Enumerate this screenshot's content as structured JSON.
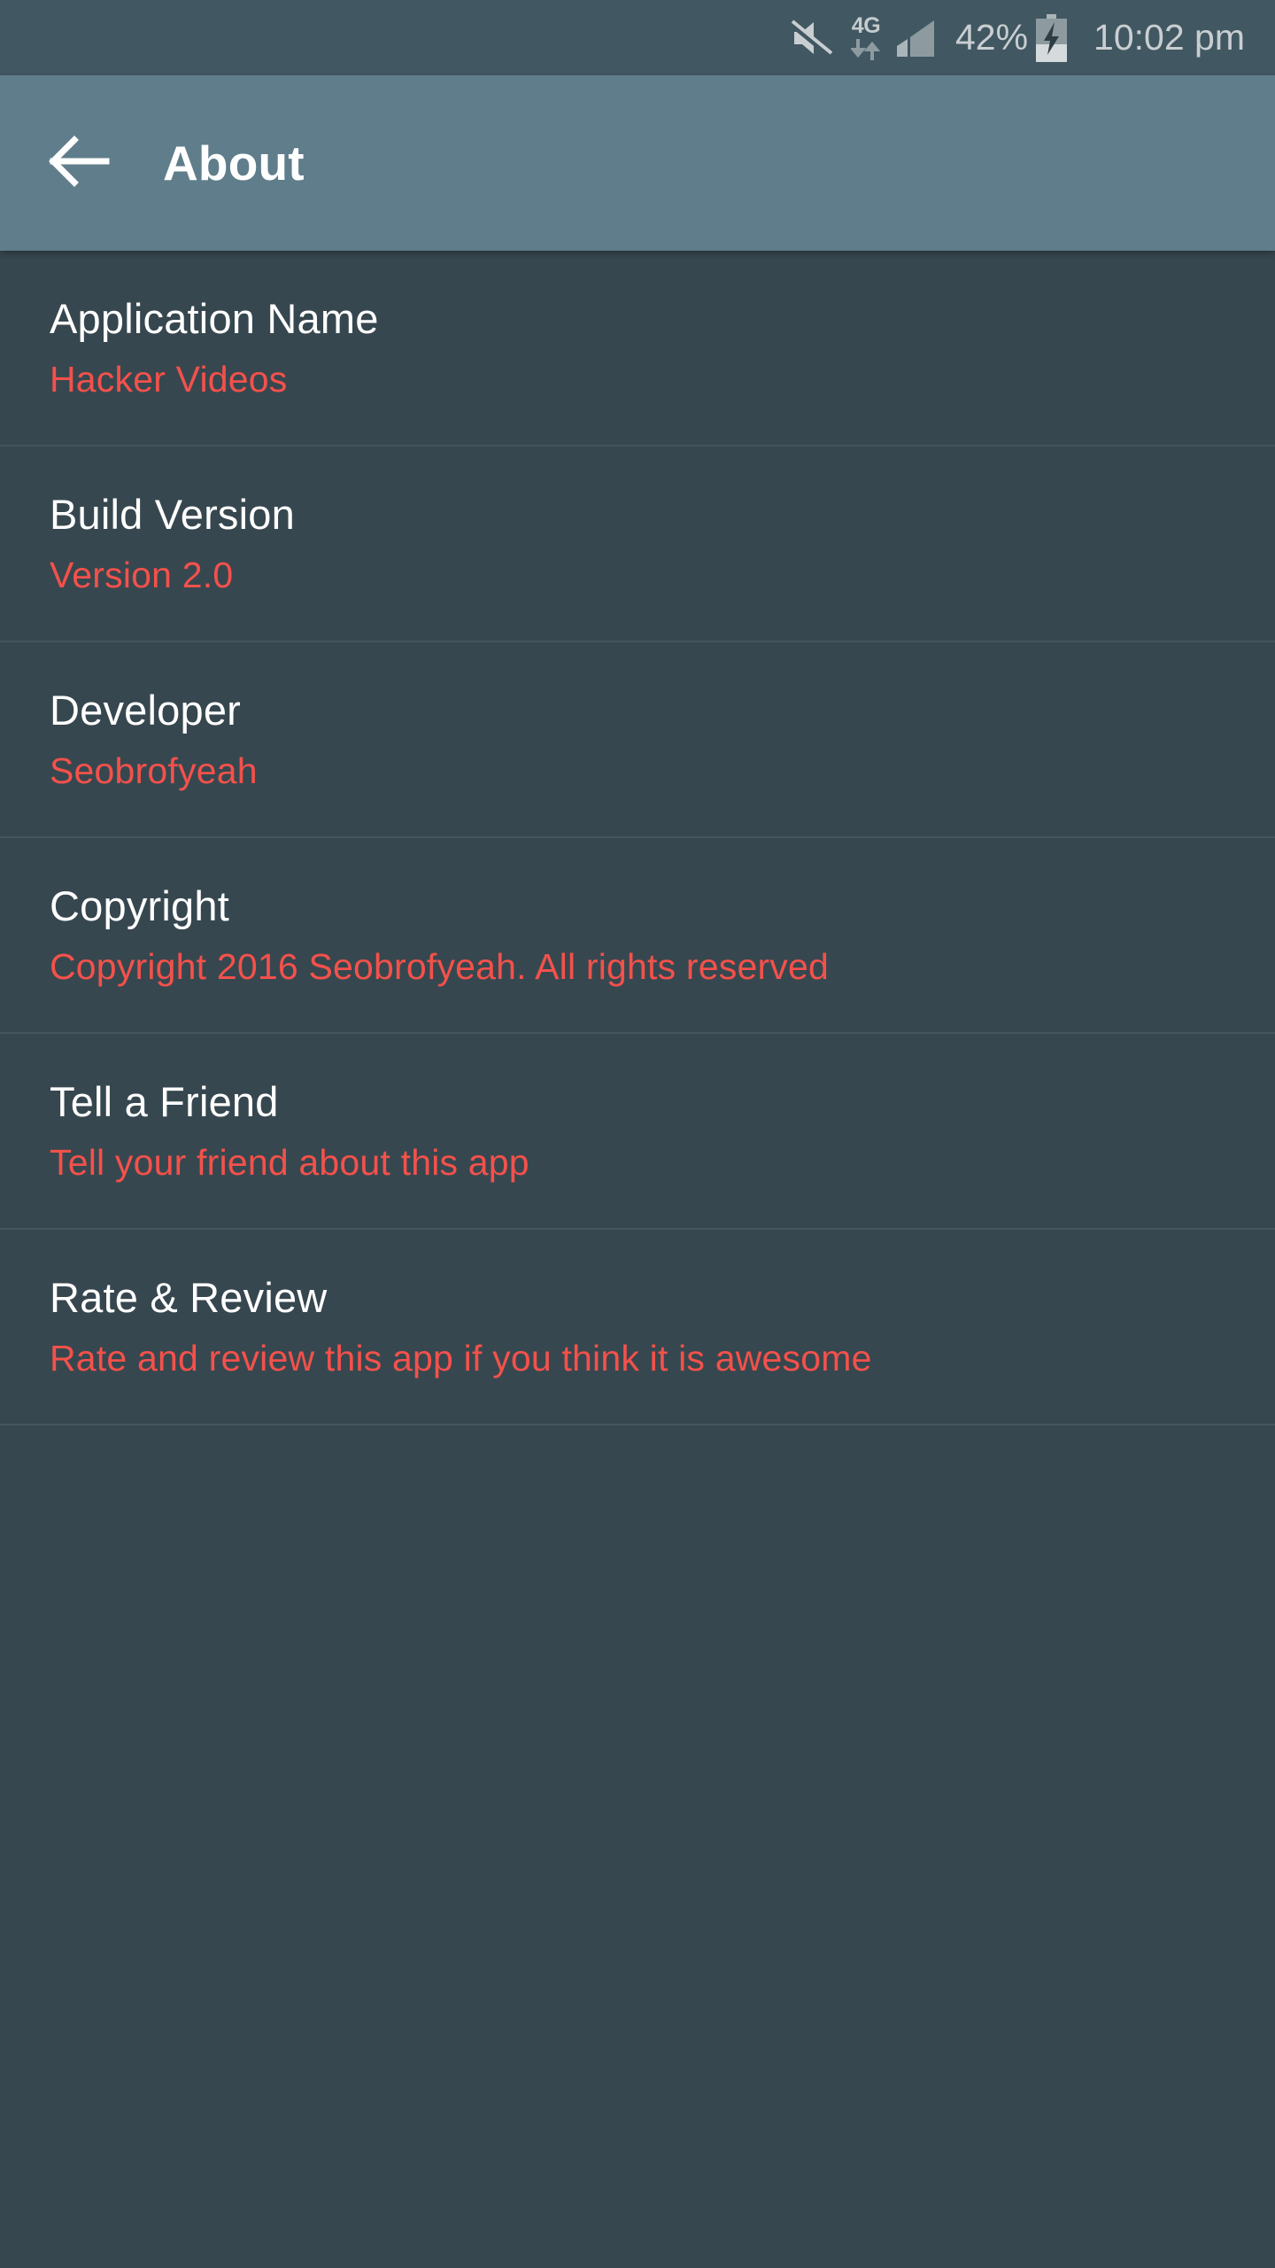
{
  "status_bar": {
    "icons": [
      "mute-icon",
      "4g-data-icon",
      "signal-icon",
      "battery-charging-icon"
    ],
    "network_label": "4G",
    "battery_percent": "42%",
    "clock": "10:02 pm"
  },
  "toolbar": {
    "back_icon": "arrow-left-icon",
    "title": "About"
  },
  "list": {
    "items": [
      {
        "title": "Application Name",
        "subtitle": "Hacker Videos"
      },
      {
        "title": "Build Version",
        "subtitle": "Version 2.0"
      },
      {
        "title": "Developer",
        "subtitle": "Seobrofyeah"
      },
      {
        "title": "Copyright",
        "subtitle": "Copyright 2016 Seobrofyeah. All rights reserved"
      },
      {
        "title": "Tell a Friend",
        "subtitle": "Tell your friend about this app"
      },
      {
        "title": "Rate & Review",
        "subtitle": "Rate and review this app if you think it is awesome"
      }
    ]
  },
  "colors": {
    "status_bar_bg": "#415761",
    "toolbar_bg": "#607d8b",
    "content_bg": "#37474f",
    "title_text": "#ffffff",
    "subtitle_accent": "#f4514b",
    "divider": "#44555e",
    "status_icon": "#c8ced1"
  }
}
